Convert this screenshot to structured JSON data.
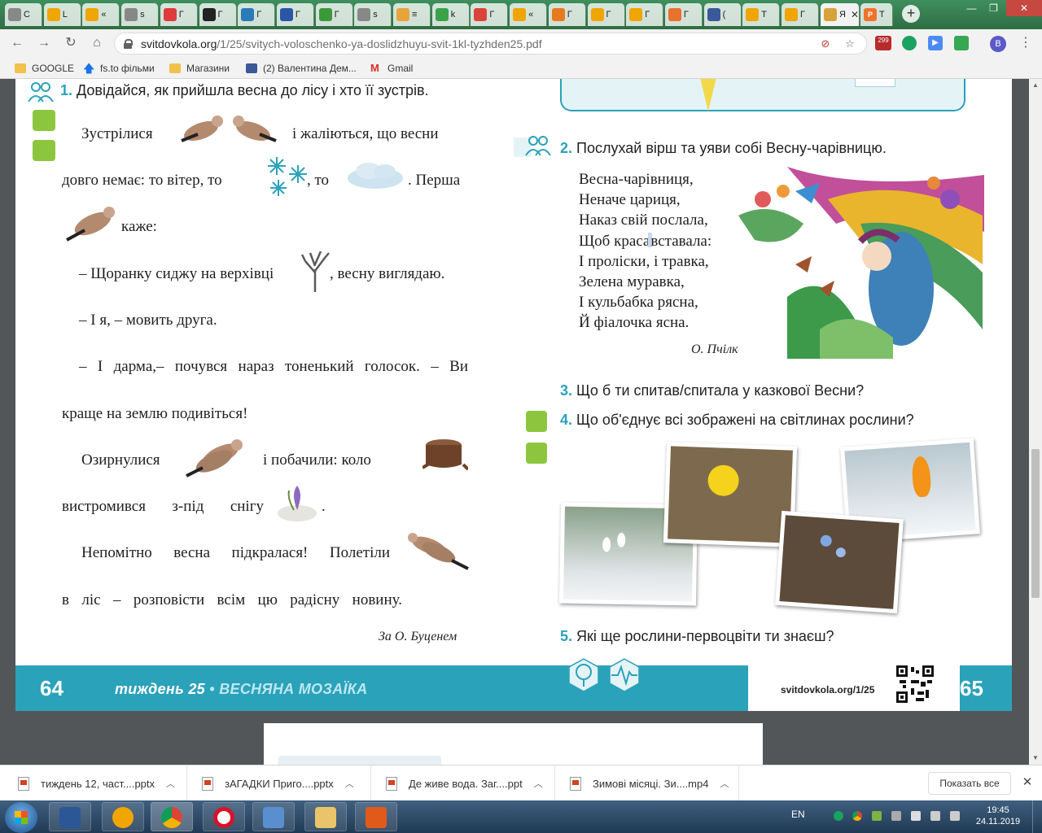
{
  "tabs": [
    {
      "icon": "globe-icon",
      "label": "С",
      "color": "#888888"
    },
    {
      "icon": "bell-icon",
      "label": "L",
      "color": "#f0a500"
    },
    {
      "icon": "bell-icon",
      "label": "«",
      "color": "#f0a500"
    },
    {
      "icon": "globe-icon",
      "label": "s",
      "color": "#888888"
    },
    {
      "icon": "power-icon",
      "label": "Г",
      "color": "#e03b3b"
    },
    {
      "icon": "wix-icon",
      "label": "Г",
      "color": "#222222"
    },
    {
      "icon": "snowflake-icon",
      "label": "Г",
      "color": "#2b7bb9"
    },
    {
      "icon": "one-icon",
      "label": "Г",
      "color": "#2b56a8"
    },
    {
      "icon": "puzzle-icon",
      "label": "Г",
      "color": "#3a9a3a"
    },
    {
      "icon": "globe-icon",
      "label": "s",
      "color": "#888888"
    },
    {
      "icon": "circle-icon",
      "label": "≡",
      "color": "#e8a33b"
    },
    {
      "icon": "flower-icon",
      "label": "k",
      "color": "#3aa34a"
    },
    {
      "icon": "thermometer-icon",
      "label": "Г",
      "color": "#d9443a"
    },
    {
      "icon": "bell-icon",
      "label": "«",
      "color": "#f0a500"
    },
    {
      "icon": "d-icon",
      "label": "Г",
      "color": "#e87a1e"
    },
    {
      "icon": "bell-icon",
      "label": "Г",
      "color": "#f0a500"
    },
    {
      "icon": "bell-icon",
      "label": "Г",
      "color": "#f0a500"
    },
    {
      "icon": "s-icon",
      "label": "Г",
      "color": "#e8712b"
    },
    {
      "icon": "facebook-icon",
      "label": "(",
      "color": "#3b5998"
    },
    {
      "icon": "ok-icon",
      "label": "Т",
      "color": "#f0a500"
    },
    {
      "icon": "ok-icon",
      "label": "Г",
      "color": "#f0a500"
    }
  ],
  "active_tab": {
    "label": "Я",
    "close": "✕"
  },
  "last_tab": {
    "label": "Т"
  },
  "new_tab_label": "+",
  "window_controls": {
    "minimize": "—",
    "restore": "❐",
    "close": "✕"
  },
  "address": {
    "host": "svitdovkola.org",
    "path": "/1/25/svitych-voloschenko-ya-doslidzhuyu-svit-1kl-tyzhden25.pdf"
  },
  "profile_initial": "B",
  "ext_badge": "299",
  "bookmarks": [
    "GOOGLE",
    "fs.to фільми",
    "Магазини",
    "(2) Валентина Дем...",
    "Gmail"
  ],
  "page_left": {
    "q1_num": "1.",
    "q1_title": "Довідайся, як прийшла весна до лісу і хто її зустрів.",
    "line1a": "Зустрілися",
    "line1b": "і жаліються, що весни",
    "line2a": "довго немає: то вітер, то",
    "line2b": ", то",
    "line2c": ". Перша",
    "line3": "каже:",
    "line4a": "– Щоранку сиджу на верхівці",
    "line4b": ", весну виглядаю.",
    "line5": "– І я, – мовить друга.",
    "line6": "– І дарма,– почувся нараз тоненький голосок. – Ви",
    "line7": "краще на землю подивіться!",
    "line8a": "Озирнулися",
    "line8b": "і побачили: коло",
    "line9a": "вистромився з-під снігу",
    "line9b": ".",
    "line10a": "Непомітно весна підкралася! Полетіли",
    "line11": "в ліс – розповісти всім цю радісну новину.",
    "author": "За О. Буценем"
  },
  "page_right": {
    "q2_num": "2.",
    "q2_text": "Послухай вірш та уяви собі Весну-чарівницю.",
    "poem": [
      "Весна-чарівниця,",
      "Неначе цариця,",
      "Наказ свій послала,",
      "Щоб краса",
      "вставала:",
      "І проліски, і травка,",
      "Зелена муравка,",
      "І кульбабка рясна,",
      "Й фіалочка ясна."
    ],
    "poem_author": "О. Пчілка",
    "q3_num": "3.",
    "q3_text": "Що б ти спитав/спитала у казкової Весни?",
    "q4_num": "4.",
    "q4_text": "Що об'єднує всі зображені на світлинах рослини?",
    "q5_num": "5.",
    "q5_text": "Які ще рослини-первоцвіти ти знаєш?"
  },
  "footer": {
    "left_page": "64",
    "week_label": "тиждень 25",
    "dot": "•",
    "theme": "ВЕСНЯНА МОЗАЇКА",
    "site": "svitdovkola.org/1/25",
    "right_page": "65"
  },
  "downloads": [
    {
      "name": "тиждень 12, част....pptx"
    },
    {
      "name": "зАГАДКИ Приго....pptx"
    },
    {
      "name": "Де живе вода. Заг....ppt"
    },
    {
      "name": "Зимові місяці. Зи....mp4"
    }
  ],
  "show_all_label": "Показать все",
  "tray": {
    "lang": "EN",
    "time": "19:45",
    "date": "24.11.2019"
  },
  "colors": {
    "accent_teal": "#2aa2ba",
    "green_icon": "#8cc63f",
    "pdf_bg": "#525659"
  }
}
